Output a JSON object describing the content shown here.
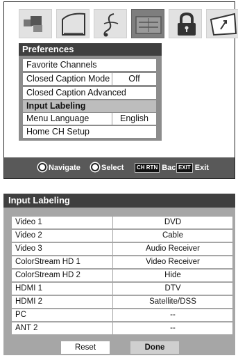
{
  "top_icons": [
    {
      "name": "picture-icon",
      "active": false
    },
    {
      "name": "sound-icon",
      "active": false
    },
    {
      "name": "music-icon",
      "active": false
    },
    {
      "name": "preferences-icon",
      "active": true
    },
    {
      "name": "lock-icon",
      "active": false
    },
    {
      "name": "setup-icon",
      "active": false
    }
  ],
  "preferences": {
    "title": "Preferences",
    "items": [
      {
        "label": "Favorite Channels",
        "value": ""
      },
      {
        "label": "Closed Caption Mode",
        "value": "Off"
      },
      {
        "label": "Closed Caption Advanced",
        "value": ""
      },
      {
        "label": "Input Labeling",
        "value": ""
      },
      {
        "label": "Menu Language",
        "value": "English"
      },
      {
        "label": "Home CH Setup",
        "value": ""
      }
    ],
    "highlighted_item": "Input Labeling"
  },
  "nav_bar": {
    "navigate": "Navigate",
    "select": "Select",
    "back_badge": "CH RTN",
    "back": "Back",
    "exit_badge": "EXIT",
    "exit": "Exit"
  },
  "input_labeling": {
    "title": "Input Labeling",
    "rows": [
      {
        "input": "Video 1",
        "label": "DVD"
      },
      {
        "input": "Video 2",
        "label": "Cable"
      },
      {
        "input": "Video 3",
        "label": "Audio Receiver"
      },
      {
        "input": "ColorStream HD 1",
        "label": "Video Receiver"
      },
      {
        "input": "ColorStream HD 2",
        "label": "Hide"
      },
      {
        "input": "HDMI 1",
        "label": "DTV"
      },
      {
        "input": "HDMI 2",
        "label": "Satellite/DSS"
      },
      {
        "input": "PC",
        "label": "--"
      },
      {
        "input": "ANT 2",
        "label": "--"
      }
    ],
    "reset": "Reset",
    "done": "Done"
  },
  "colors": {
    "title_bar": "#3f3f3f",
    "menu_bg": "#8c8c8c",
    "highlight": "#bdbdbd",
    "nav_bar": "#595959",
    "table_bg": "#a6a6a6"
  }
}
